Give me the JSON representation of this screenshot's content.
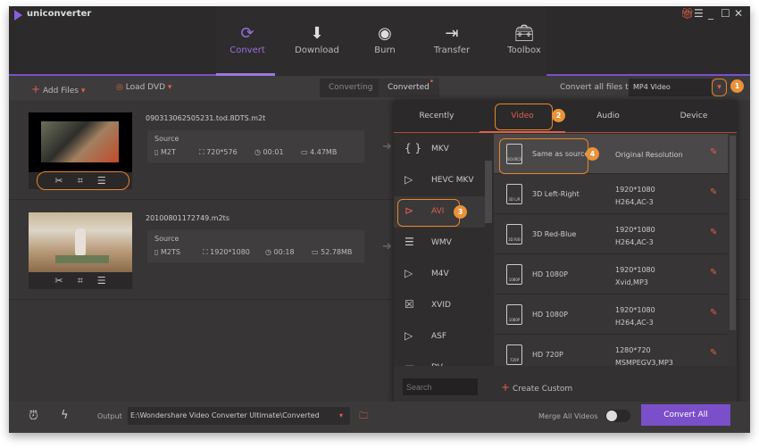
{
  "app": {
    "title": "uniconverter",
    "icons": [
      "gift-icon",
      "menu-icon",
      "minimize-icon",
      "maximize-icon",
      "close-icon"
    ]
  },
  "nav": [
    {
      "label": "Convert",
      "icon": "convert-icon"
    },
    {
      "label": "Download",
      "icon": "download-icon"
    },
    {
      "label": "Burn",
      "icon": "burn-icon"
    },
    {
      "label": "Transfer",
      "icon": "transfer-icon"
    },
    {
      "label": "Toolbox",
      "icon": "toolbox-icon"
    }
  ],
  "toolbar": {
    "add_files": "Add Files",
    "load_dvd": "Load DVD",
    "converting": "Converting",
    "converted": "Converted",
    "convert_all_to": "Convert all files to:",
    "format": "MP4 Video"
  },
  "files": [
    {
      "name": "090313062505231.tod.8DTS.m2t",
      "source": "Source",
      "format": "M2T",
      "resolution": "720*576",
      "duration": "00:01",
      "size": "4.47MB"
    },
    {
      "name": "20100801172749.m2ts",
      "source": "Source",
      "format": "M2TS",
      "resolution": "1920*1080",
      "duration": "00:18",
      "size": "52.78MB"
    }
  ],
  "popup": {
    "tabs": [
      "Recently",
      "Video",
      "Audio",
      "Device"
    ],
    "active_tab": "Video",
    "formats": [
      "MKV",
      "HEVC MKV",
      "AVI",
      "WMV",
      "M4V",
      "XVID",
      "ASF",
      "DV"
    ],
    "selected_format": "AVI",
    "presets": [
      {
        "name": "Same as source",
        "res": "Original Resolution",
        "codec": "",
        "tag": "SOURCE"
      },
      {
        "name": "3D Left-Right",
        "res": "1920*1080",
        "codec": "H264,AC-3",
        "tag": "3D L/R"
      },
      {
        "name": "3D Red-Blue",
        "res": "1920*1080",
        "codec": "H264,AC-3",
        "tag": "3D R/B"
      },
      {
        "name": "HD 1080P",
        "res": "1920*1080",
        "codec": "Xvid,MP3",
        "tag": "1080P"
      },
      {
        "name": "HD 1080P",
        "res": "1920*1080",
        "codec": "H264,AC-3",
        "tag": "1080P"
      },
      {
        "name": "HD 720P",
        "res": "1280*720",
        "codec": "MSMPEGV3,MP3",
        "tag": "720P"
      }
    ],
    "search_placeholder": "Search",
    "create_custom": "Create Custom"
  },
  "badges": [
    "1",
    "2",
    "3",
    "4"
  ],
  "bottom": {
    "output_label": "Output",
    "output_path": "E:\\Wondershare Video Converter Ultimate\\Converted",
    "merge": "Merge All Videos",
    "merge_on": false,
    "convert_all": "Convert All"
  },
  "colors": {
    "accent": "#7b4fc9",
    "highlight": "#e9852a",
    "selected_text": "#e0604c"
  }
}
